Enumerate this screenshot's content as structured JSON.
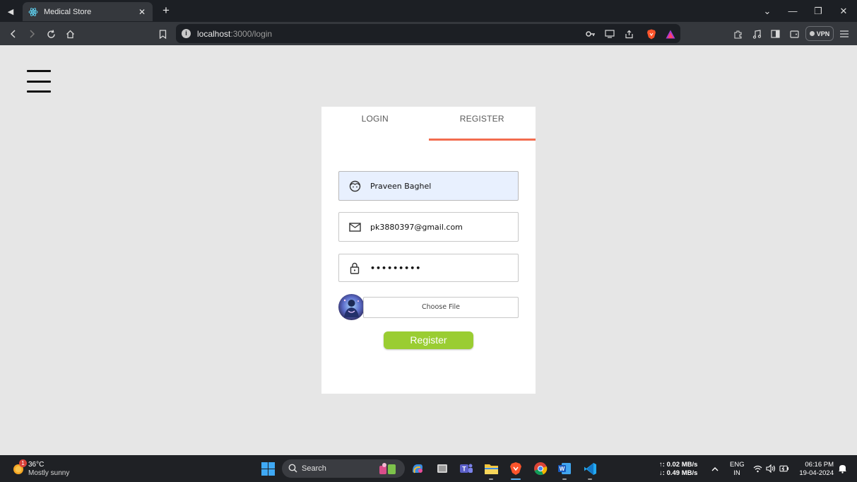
{
  "browser": {
    "tab_title": "Medical Store",
    "url_host": "localhost",
    "url_path": ":3000/login",
    "vpn_label": "VPN"
  },
  "auth": {
    "tabs": [
      {
        "label": "LOGIN",
        "active": false
      },
      {
        "label": "REGISTER",
        "active": true
      }
    ],
    "accent_color": "#f26c4f",
    "name_value": "Praveen Baghel",
    "email_value": "pk3880397@gmail.com",
    "password_value": "•••••••••",
    "file_button_label": "Choose File",
    "submit_label": "Register",
    "submit_color": "#9acd32"
  },
  "taskbar": {
    "weather_badge": "1",
    "weather_temp": "36°C",
    "weather_condition": "Mostly sunny",
    "search_label": "Search",
    "net_up": "0.02 MB/s",
    "net_down": "0.49 MB/s",
    "lang_line1": "ENG",
    "lang_line2": "IN",
    "time": "06:16 PM",
    "date": "19-04-2024"
  }
}
